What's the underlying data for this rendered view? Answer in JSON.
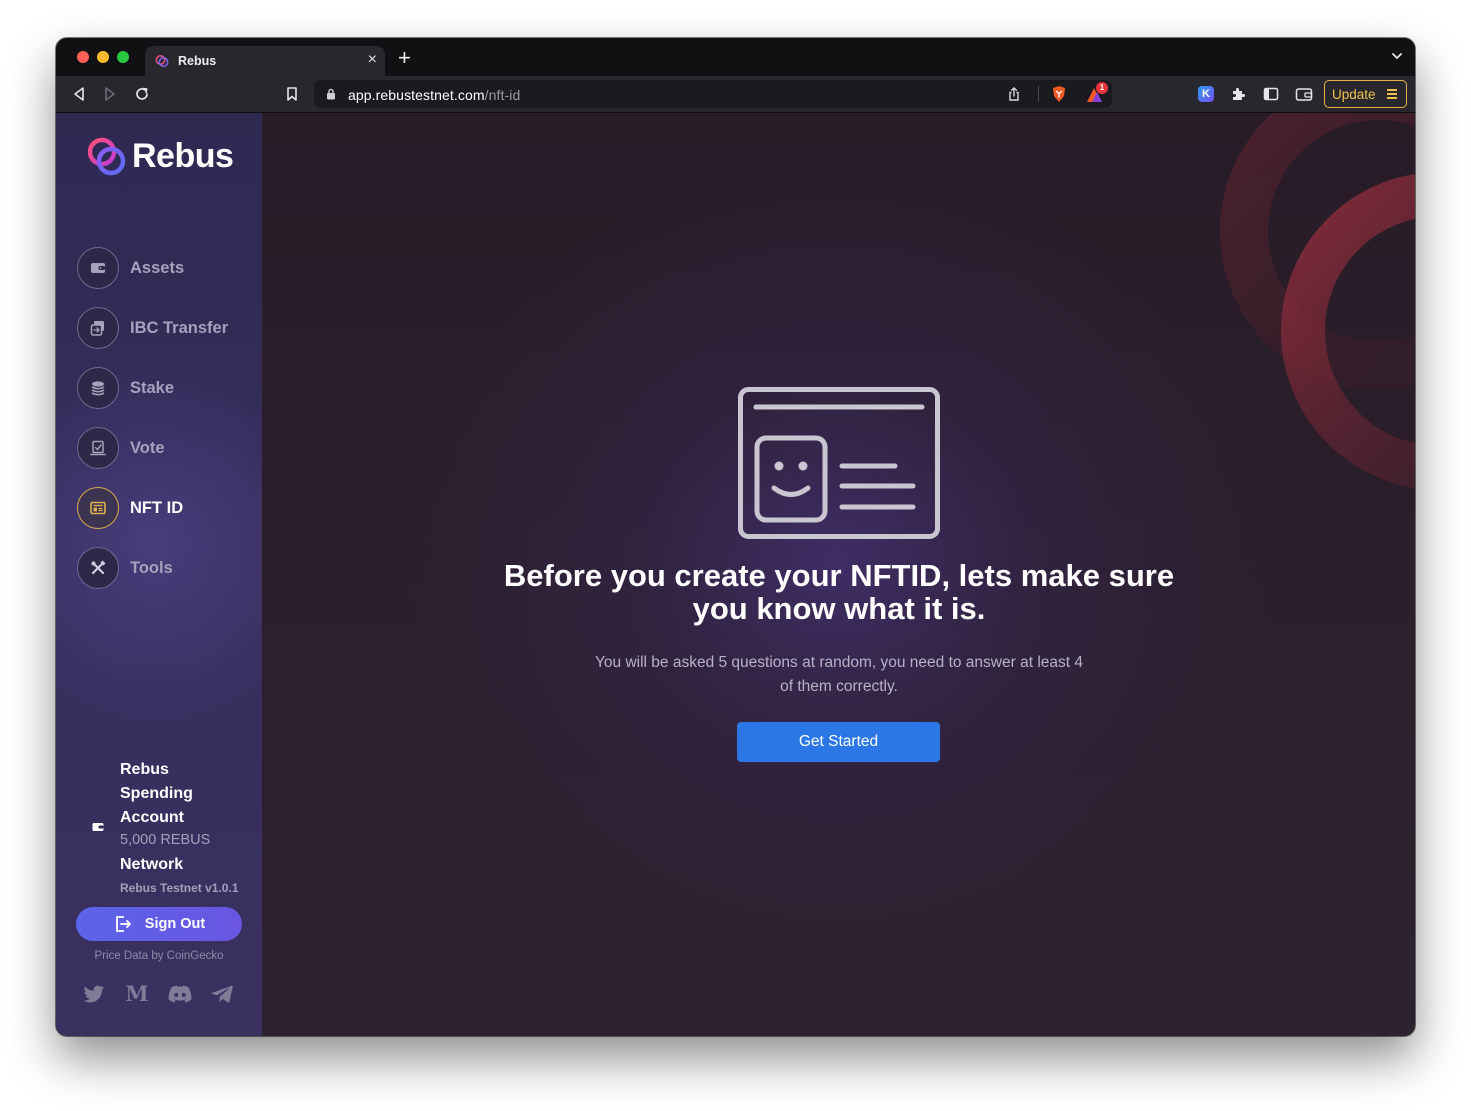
{
  "browser": {
    "tab": {
      "title": "Rebus"
    },
    "url": {
      "host": "app.rebustestnet.com",
      "path": "/nft-id"
    },
    "update_label": "Update",
    "notification_badge": "1"
  },
  "sidebar": {
    "logo_text": "Rebus",
    "items": [
      {
        "label": "Assets",
        "icon": "wallet-icon",
        "active": false
      },
      {
        "label": "IBC Transfer",
        "icon": "transfer-icon",
        "active": false
      },
      {
        "label": "Stake",
        "icon": "coins-icon",
        "active": false
      },
      {
        "label": "Vote",
        "icon": "ballot-icon",
        "active": false
      },
      {
        "label": "NFT ID",
        "icon": "id-card-icon",
        "active": true
      },
      {
        "label": "Tools",
        "icon": "tools-icon",
        "active": false
      }
    ],
    "account": {
      "name": "Rebus Spending Account",
      "balance": "5,000 REBUS"
    },
    "network": {
      "title": "Network",
      "version": "Rebus Testnet v1.0.1"
    },
    "sign_out_label": "Sign Out",
    "price_credit": "Price Data by CoinGecko",
    "social": [
      "twitter-icon",
      "medium-icon",
      "discord-icon",
      "telegram-icon"
    ],
    "medium_glyph": "M"
  },
  "main": {
    "headline": "Before you create your NFTID, lets make sure you know what it is.",
    "subtext": "You will be asked 5 questions at random, you need to answer at least 4 of them correctly.",
    "cta_label": "Get Started"
  },
  "colors": {
    "accent_blue": "#2b77e5",
    "active_ring": "#d9a94a",
    "sign_out_gradient": [
      "#5b64ea",
      "#6a55e0"
    ],
    "update_gold": "#f0c04f"
  }
}
